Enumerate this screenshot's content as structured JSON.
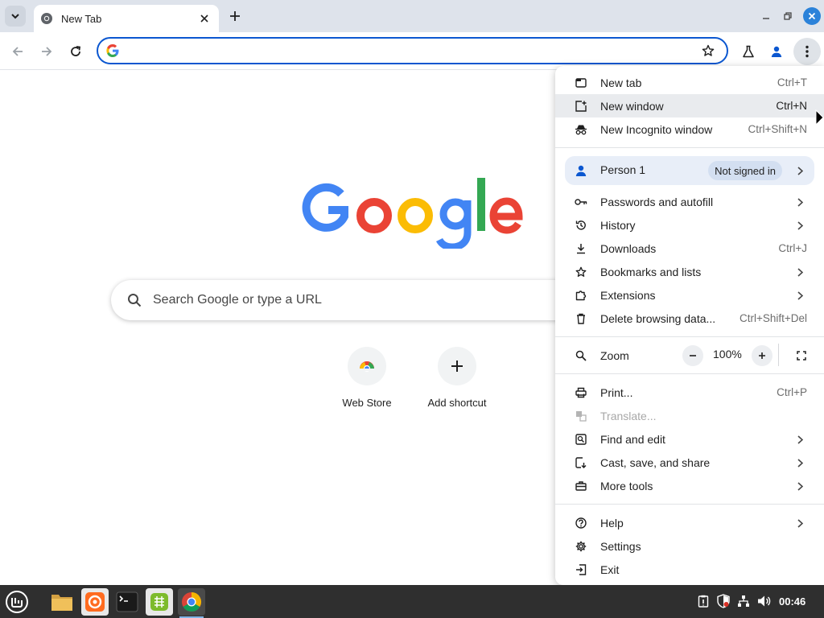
{
  "tab": {
    "title": "New Tab"
  },
  "omnibox": {
    "value": "",
    "placeholder": ""
  },
  "ntp": {
    "search_placeholder": "Search Google or type a URL",
    "shortcuts": [
      {
        "label": "Web Store",
        "icon": "web-store-icon"
      },
      {
        "label": "Add shortcut",
        "icon": "plus-icon"
      }
    ]
  },
  "menu": {
    "items": [
      {
        "id": "new-tab",
        "label": "New tab",
        "shortcut": "Ctrl+T",
        "icon": "new-tab-icon"
      },
      {
        "id": "new-window",
        "label": "New window",
        "shortcut": "Ctrl+N",
        "icon": "new-window-icon",
        "hovered": true
      },
      {
        "id": "new-incognito-window",
        "label": "New Incognito window",
        "shortcut": "Ctrl+Shift+N",
        "icon": "incognito-icon"
      },
      {
        "id": "passwords-and-autofill",
        "label": "Passwords and autofill",
        "icon": "key-icon",
        "submenu": true
      },
      {
        "id": "history",
        "label": "History",
        "icon": "history-icon",
        "submenu": true
      },
      {
        "id": "downloads",
        "label": "Downloads",
        "shortcut": "Ctrl+J",
        "icon": "download-icon"
      },
      {
        "id": "bookmarks-and-lists",
        "label": "Bookmarks and lists",
        "icon": "star-icon",
        "submenu": true
      },
      {
        "id": "extensions",
        "label": "Extensions",
        "icon": "puzzle-icon",
        "submenu": true
      },
      {
        "id": "delete-browsing-data",
        "label": "Delete browsing data...",
        "shortcut": "Ctrl+Shift+Del",
        "icon": "trash-icon"
      },
      {
        "id": "print",
        "label": "Print...",
        "shortcut": "Ctrl+P",
        "icon": "printer-icon"
      },
      {
        "id": "translate",
        "label": "Translate...",
        "icon": "translate-icon",
        "disabled": true
      },
      {
        "id": "find-and-edit",
        "label": "Find and edit",
        "icon": "find-icon",
        "submenu": true
      },
      {
        "id": "cast-save-share",
        "label": "Cast, save, and share",
        "icon": "cast-icon",
        "submenu": true
      },
      {
        "id": "more-tools",
        "label": "More tools",
        "icon": "toolbox-icon",
        "submenu": true
      },
      {
        "id": "help",
        "label": "Help",
        "icon": "help-icon",
        "submenu": true
      },
      {
        "id": "settings",
        "label": "Settings",
        "icon": "gear-icon"
      },
      {
        "id": "exit",
        "label": "Exit",
        "icon": "exit-icon"
      }
    ],
    "person": {
      "name": "Person 1",
      "status": "Not signed in"
    },
    "zoom": {
      "label": "Zoom",
      "value": "100%"
    }
  },
  "taskbar": {
    "clock": "00:46",
    "apps": [
      "mint-menu-icon",
      "files-icon",
      "firefox-icon",
      "terminal-icon",
      "spreadsheet-icon",
      "chrome-icon"
    ]
  }
}
